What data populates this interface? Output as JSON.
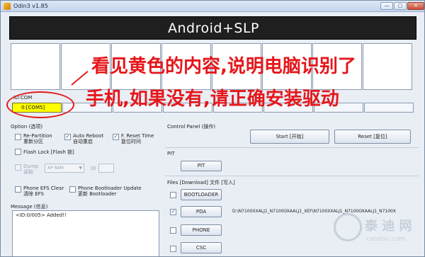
{
  "window": {
    "title": "Odin3 v1.85",
    "minimize": "—",
    "maximize": "▢",
    "close": "✕"
  },
  "banner": {
    "title": "Android+SLP"
  },
  "id_com": {
    "label": "ID:COM",
    "port_value": "0:[COM5]"
  },
  "overlay": {
    "line1": "看见黄色的内容,说明电脑识别了",
    "line2": "手机,如果没有,请正确安装驱动"
  },
  "option": {
    "title": "Option (选项)",
    "re_partition": "Re-Partition\n重新分区",
    "auto_reboot": "Auto Reboot\n自动重启",
    "f_reset_time": "F. Reset Time\n复位时间",
    "flash_lock": "Flash Lock [Flash 锁]",
    "dump": "Dump\n读取",
    "dump_select": "AP RAM",
    "id_label": "ID",
    "phone_efs_clear": "Phone EFS Clear\n清除 EFS",
    "phone_bootloader_update": "Phone Bootloader Update\n更新 Bootloader"
  },
  "message": {
    "title": "Message (信息)",
    "log": "<ID:0/005> Added!!"
  },
  "control_panel": {
    "title": "Control Panel (操作)",
    "start": "Start [开始]",
    "reset": "Reset [复位]"
  },
  "pit": {
    "title": "PIT",
    "button": "PIT"
  },
  "files": {
    "title": "Files [Download] 文件 [写入]",
    "bootloader": "BOOTLOADER",
    "pda": "PDA",
    "pda_path": "D:\\N7100XXALJ1_N7100OXAALJ1_XEF\\N7100XXALJ1_N7100OXAALJ1_N7100X",
    "phone": "PHONE",
    "csc": "CSC"
  },
  "watermark": {
    "name": "泰 迪 网",
    "site": "candou.com"
  },
  "checkbox_marks": {
    "auto_reboot": "✓",
    "f_reset_time": "✓",
    "pda": "✓"
  }
}
